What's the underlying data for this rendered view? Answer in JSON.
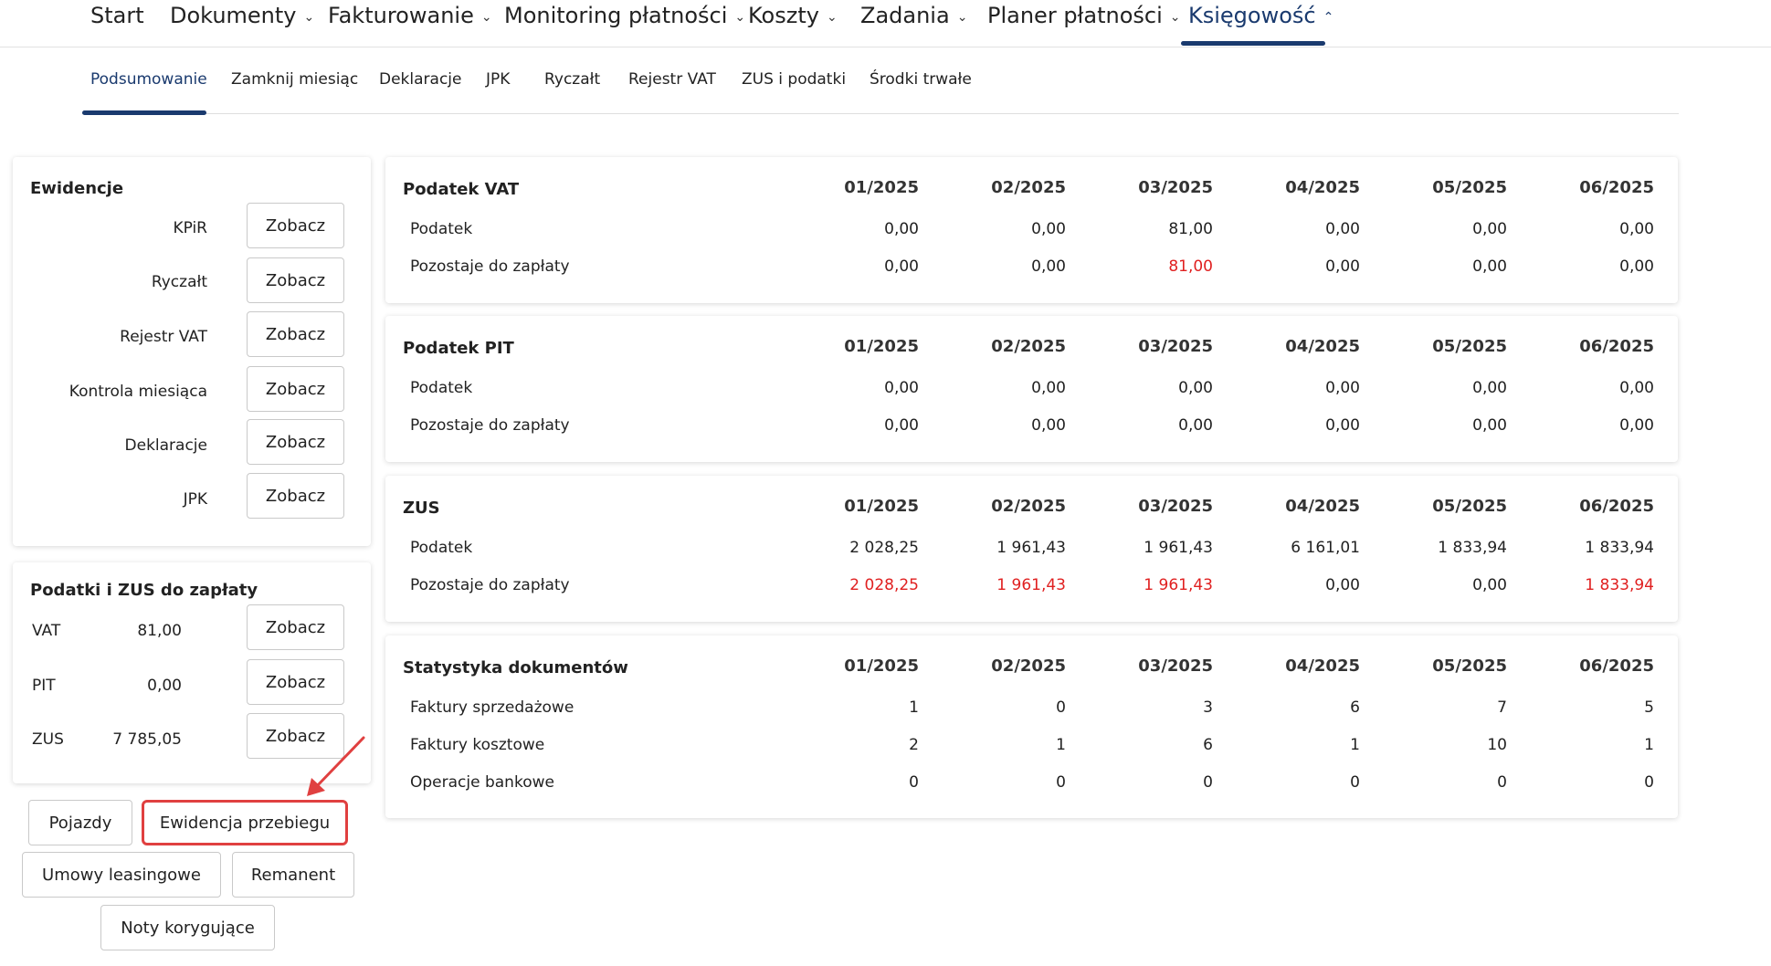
{
  "topnav": {
    "items": [
      {
        "label": "Start",
        "has_menu": false
      },
      {
        "label": "Dokumenty",
        "has_menu": true
      },
      {
        "label": "Fakturowanie",
        "has_menu": true
      },
      {
        "label": "Monitoring płatności",
        "has_menu": true
      },
      {
        "label": "Koszty",
        "has_menu": true
      },
      {
        "label": "Zadania",
        "has_menu": true
      },
      {
        "label": "Planer płatności",
        "has_menu": true
      },
      {
        "label": "Księgowość",
        "has_menu": true,
        "active": true
      }
    ],
    "chevron_down": "⌄",
    "chevron_up": "⌃"
  },
  "subnav": {
    "items": [
      {
        "label": "Podsumowanie",
        "active": true
      },
      {
        "label": "Zamknij miesiąc"
      },
      {
        "label": "Deklaracje"
      },
      {
        "label": "JPK"
      },
      {
        "label": "Ryczałt"
      },
      {
        "label": "Rejestr VAT"
      },
      {
        "label": "ZUS i podatki"
      },
      {
        "label": "Środki trwałe"
      }
    ]
  },
  "ewidencje": {
    "title": "Ewidencje",
    "button_label": "Zobacz",
    "rows": [
      {
        "label": "KPiR"
      },
      {
        "label": "Ryczałt"
      },
      {
        "label": "Rejestr VAT"
      },
      {
        "label": "Kontrola miesiąca"
      },
      {
        "label": "Deklaracje"
      },
      {
        "label": "JPK"
      }
    ]
  },
  "podatki_zus": {
    "title": "Podatki i ZUS do zapłaty",
    "button_label": "Zobacz",
    "rows": [
      {
        "label": "VAT",
        "value": "81,00"
      },
      {
        "label": "PIT",
        "value": "0,00"
      },
      {
        "label": "ZUS",
        "value": "7 785,05"
      }
    ]
  },
  "bottom_buttons": {
    "pojazdy": "Pojazdy",
    "ewidencja_przebiegu": "Ewidencja przebiegu",
    "umowy_leasingowe": "Umowy leasingowe",
    "remanent": "Remanent",
    "noty_korygujace": "Noty korygujące"
  },
  "periods": [
    "01/2025",
    "02/2025",
    "03/2025",
    "04/2025",
    "05/2025",
    "06/2025"
  ],
  "tables": [
    {
      "title": "Podatek VAT",
      "rows": [
        {
          "label": "Podatek",
          "values": [
            "0,00",
            "0,00",
            "81,00",
            "0,00",
            "0,00",
            "0,00"
          ],
          "due": [
            false,
            false,
            false,
            false,
            false,
            false
          ]
        },
        {
          "label": "Pozostaje do zapłaty",
          "values": [
            "0,00",
            "0,00",
            "81,00",
            "0,00",
            "0,00",
            "0,00"
          ],
          "due": [
            false,
            false,
            true,
            false,
            false,
            false
          ]
        }
      ]
    },
    {
      "title": "Podatek PIT",
      "rows": [
        {
          "label": "Podatek",
          "values": [
            "0,00",
            "0,00",
            "0,00",
            "0,00",
            "0,00",
            "0,00"
          ],
          "due": [
            false,
            false,
            false,
            false,
            false,
            false
          ]
        },
        {
          "label": "Pozostaje do zapłaty",
          "values": [
            "0,00",
            "0,00",
            "0,00",
            "0,00",
            "0,00",
            "0,00"
          ],
          "due": [
            false,
            false,
            false,
            false,
            false,
            false
          ]
        }
      ]
    },
    {
      "title": "ZUS",
      "rows": [
        {
          "label": "Podatek",
          "values": [
            "2 028,25",
            "1 961,43",
            "1 961,43",
            "6 161,01",
            "1 833,94",
            "1 833,94"
          ],
          "due": [
            false,
            false,
            false,
            false,
            false,
            false
          ]
        },
        {
          "label": "Pozostaje do zapłaty",
          "values": [
            "2 028,25",
            "1 961,43",
            "1 961,43",
            "0,00",
            "0,00",
            "1 833,94"
          ],
          "due": [
            true,
            true,
            true,
            false,
            false,
            true
          ]
        }
      ]
    },
    {
      "title": "Statystyka dokumentów",
      "rows": [
        {
          "label": "Faktury sprzedażowe",
          "values": [
            "1",
            "0",
            "3",
            "6",
            "7",
            "5"
          ],
          "due": [
            false,
            false,
            false,
            false,
            false,
            false
          ]
        },
        {
          "label": "Faktury kosztowe",
          "values": [
            "2",
            "1",
            "6",
            "1",
            "10",
            "1"
          ],
          "due": [
            false,
            false,
            false,
            false,
            false,
            false
          ]
        },
        {
          "label": "Operacje bankowe",
          "values": [
            "0",
            "0",
            "0",
            "0",
            "0",
            "0"
          ],
          "due": [
            false,
            false,
            false,
            false,
            false,
            false
          ]
        }
      ]
    }
  ],
  "colors": {
    "accent": "#1a3a6e",
    "due": "#e02020",
    "annotation": "#e04040"
  }
}
